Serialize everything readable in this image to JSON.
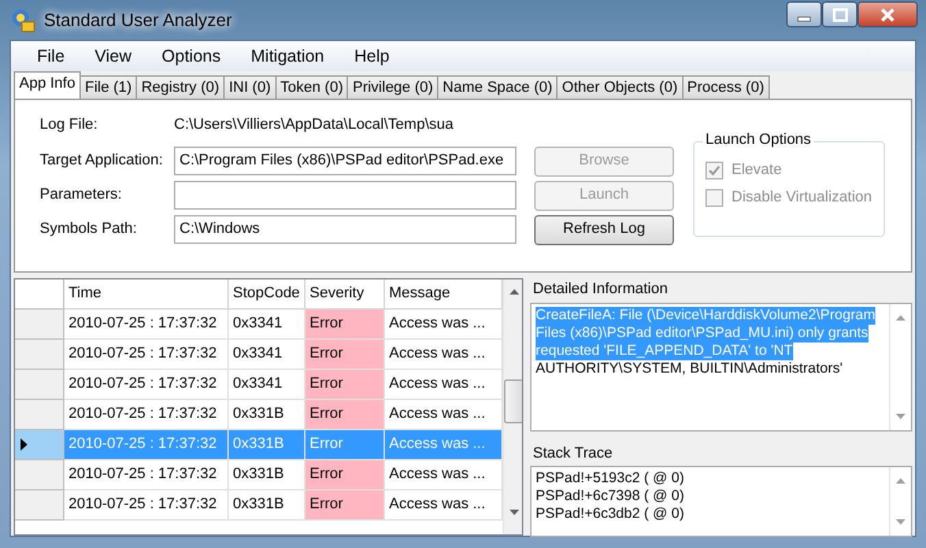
{
  "window": {
    "title": "Standard User Analyzer"
  },
  "menu": [
    "File",
    "View",
    "Options",
    "Mitigation",
    "Help"
  ],
  "tabs": [
    {
      "label": "App Info",
      "selected": true
    },
    {
      "label": "File (1)",
      "selected": false
    },
    {
      "label": "Registry (0)",
      "selected": false
    },
    {
      "label": "INI (0)",
      "selected": false
    },
    {
      "label": "Token (0)",
      "selected": false
    },
    {
      "label": "Privilege (0)",
      "selected": false
    },
    {
      "label": "Name Space (0)",
      "selected": false
    },
    {
      "label": "Other Objects (0)",
      "selected": false
    },
    {
      "label": "Process (0)",
      "selected": false
    }
  ],
  "app_info": {
    "log_file": {
      "label": "Log File:",
      "value": "C:\\Users\\Villiers\\AppData\\Local\\Temp\\sua"
    },
    "fields": [
      {
        "label": "Target Application:",
        "value": "C:\\Program Files (x86)\\PSPad editor\\PSPad.exe"
      },
      {
        "label": "Parameters:"
      },
      {
        "label": "Symbols Path:",
        "value": "C:\\Windows"
      }
    ],
    "buttons": [
      {
        "label": "Browse",
        "disabled": true
      },
      {
        "label": "Launch",
        "disabled": true
      },
      {
        "label": "Refresh Log",
        "disabled": false
      }
    ],
    "launch_options": {
      "title": "Launch Options",
      "options": [
        {
          "label": "Elevate",
          "checked": true,
          "disabled": true
        },
        {
          "label": "Disable Virtualization",
          "checked": false,
          "disabled": true
        }
      ]
    }
  },
  "table": {
    "columns": [
      "Time",
      "StopCode",
      "Severity",
      "Message"
    ],
    "rows": [
      {
        "time": "2010-07-25 : 17:37:32",
        "stopcode": "0x3341",
        "severity": "Error",
        "message": "Access was ...",
        "selected": false
      },
      {
        "time": "2010-07-25 : 17:37:32",
        "stopcode": "0x3341",
        "severity": "Error",
        "message": "Access was ...",
        "selected": false
      },
      {
        "time": "2010-07-25 : 17:37:32",
        "stopcode": "0x3341",
        "severity": "Error",
        "message": "Access was ...",
        "selected": false
      },
      {
        "time": "2010-07-25 : 17:37:32",
        "stopcode": "0x331B",
        "severity": "Error",
        "message": "Access was ...",
        "selected": false
      },
      {
        "time": "2010-07-25 : 17:37:32",
        "stopcode": "0x331B",
        "severity": "Error",
        "message": "Access was ...",
        "selected": true
      },
      {
        "time": "2010-07-25 : 17:37:32",
        "stopcode": "0x331B",
        "severity": "Error",
        "message": "Access was ...",
        "selected": false
      },
      {
        "time": "2010-07-25 : 17:37:32",
        "stopcode": "0x331B",
        "severity": "Error",
        "message": "Access was ...",
        "selected": false
      }
    ]
  },
  "detailed_information": {
    "label": "Detailed Information",
    "selected_lines": [
      "CreateFileA: File (\\Device\\HarddiskVolume2\\Program",
      "Files (x86)\\PSPad editor\\PSPad_MU.ini) only grants",
      "requested 'FILE_APPEND_DATA' to 'NT"
    ],
    "text": "AUTHORITY\\SYSTEM, BUILTIN\\Administrators'"
  },
  "stack_trace": {
    "label": "Stack Trace",
    "lines": [
      "PSPad!+5193c2 ( @ 0)",
      "PSPad!+6c7398 ( @ 0)",
      "PSPad!+6c3db2 ( @ 0)"
    ]
  }
}
